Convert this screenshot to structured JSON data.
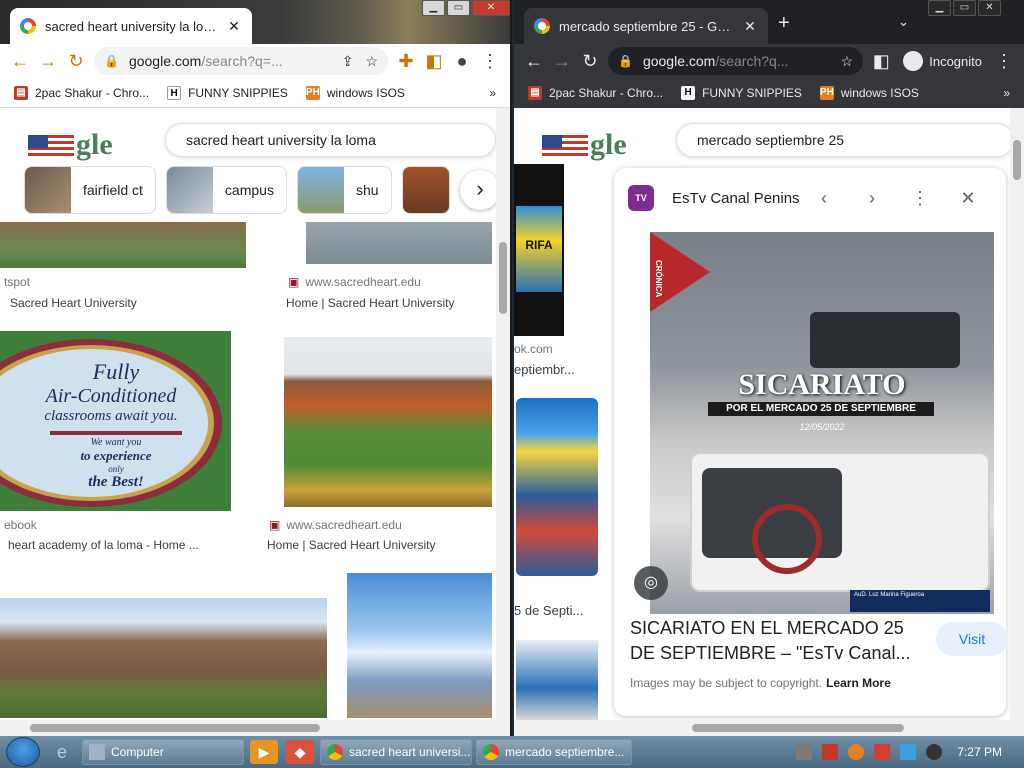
{
  "left": {
    "tab_title": "sacred heart university la loma -",
    "url_main": "google.com",
    "url_rest": "/search?q=...",
    "bookmarks": [
      "2pac Shakur - Chro...",
      "FUNNY SNIPPIES",
      "windows ISOS"
    ],
    "search_query": "sacred heart university la loma",
    "chips": [
      "fairfield ct",
      "campus",
      "shu"
    ],
    "results": [
      {
        "source": "tspot",
        "title": "Sacred Heart University"
      },
      {
        "source": "www.sacredheart.edu",
        "title": "Home | Sacred Heart University"
      },
      {
        "source": "ebook",
        "title": "heart academy of la loma - Home ..."
      },
      {
        "source": "www.sacredheart.edu",
        "title": "Home | Sacred Heart University"
      }
    ],
    "poster": {
      "line1": "Fully",
      "line2": "Air-Conditioned",
      "line3": "classrooms await you.",
      "line4": "We want you",
      "line5": "to experience",
      "line6": "only",
      "line7": "the Best!"
    }
  },
  "right": {
    "tab_title": "mercado septiembre 25 - Google",
    "url_main": "google.com",
    "url_rest": "/search?q...",
    "incognito_label": "Incognito",
    "bookmarks": [
      "2pac Shakur - Chro...",
      "FUNNY SNIPPIES",
      "windows ISOS"
    ],
    "search_query": "mercado septiembre 25",
    "left_strip": {
      "source": "ok.com",
      "title": "eptiembr...",
      "title2": "5 de Septi...",
      "banner": "RIFA"
    },
    "panel": {
      "site_name": "EsTv Canal Peninsul...",
      "hero_title": "SICARIATO",
      "hero_sub": "POR EL MERCADO 25 DE SEPTIEMBRE",
      "hero_date": "12/05/2022",
      "hero_side": "CRÓNICA",
      "hero_credit": "AuD. Luz Marina Figueroa",
      "title": "SICARIATO EN EL MERCADO 25 DE SEPTIEMBRE – \"EsTv Canal...",
      "visit": "Visit",
      "copyright": "Images may be subject to copyright.",
      "learn_more": "Learn More"
    }
  },
  "taskbar": {
    "buttons": [
      "Computer",
      "sacred heart universi...",
      "mercado septiembre..."
    ],
    "clock": "7:27 PM"
  },
  "colors": {
    "accent": "#1a73e8",
    "incognito_bar": "#35363a",
    "tab_dark": "#202124"
  }
}
